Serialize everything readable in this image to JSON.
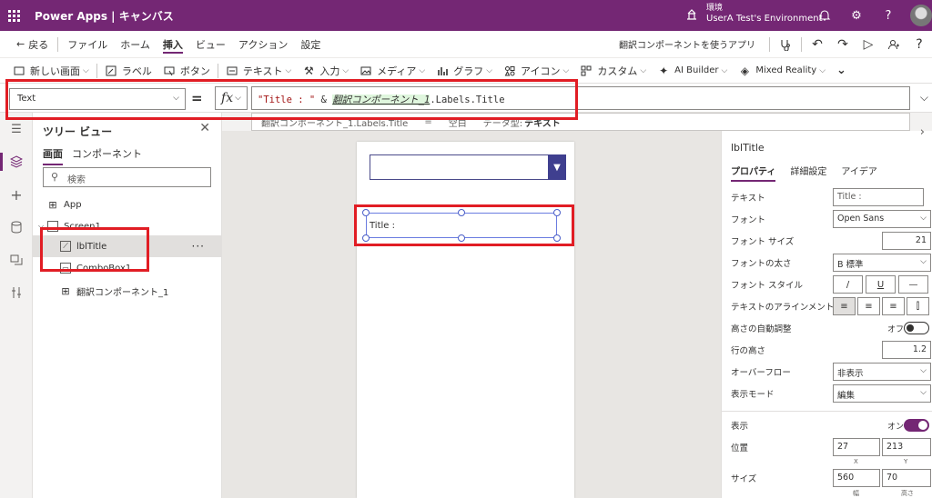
{
  "topbar": {
    "app_title": "Power Apps | キャンバス",
    "env_label": "環境",
    "env_name": "UserA Test's Environment"
  },
  "menu": {
    "back": "戻る",
    "items": [
      "ファイル",
      "ホーム",
      "挿入",
      "ビュー",
      "アクション",
      "設定"
    ],
    "active_item": "挿入",
    "app_name": "翻訳コンポーネントを使うアプリ"
  },
  "toolbar": {
    "new_screen": "新しい画面",
    "label": "ラベル",
    "button": "ボタン",
    "text": "テキスト",
    "input": "入力",
    "media": "メディア",
    "chart": "グラフ",
    "icons": "アイコン",
    "custom": "カスタム",
    "ai_builder": "AI Builder",
    "mixed_reality": "Mixed Reality"
  },
  "formula_bar": {
    "property": "Text",
    "equals": "=",
    "fx": "fx",
    "formula_string": "\"Title : \"",
    "formula_op": " & ",
    "formula_ref": "翻訳コンポーネント_1",
    "formula_tail": ".Labels.Title",
    "hint_expr": "翻訳コンポーネント_1.Labels.Title",
    "hint_eq": "=",
    "hint_value": "空白",
    "hint_type_label": "データ型:",
    "hint_type": "テキスト"
  },
  "tree": {
    "title": "ツリー ビュー",
    "tabs": [
      "画面",
      "コンポーネント"
    ],
    "search_placeholder": "検索",
    "items": {
      "app": "App",
      "screen": "Screen1",
      "label": "lblTitle",
      "combo": "ComboBox1",
      "component": "翻訳コンポーネント_1"
    },
    "more": "···"
  },
  "canvas": {
    "label_text": "Title :"
  },
  "props": {
    "control_name": "lblTitle",
    "tabs": [
      "プロパティ",
      "詳細設定",
      "アイデア"
    ],
    "rows": {
      "text_label": "テキスト",
      "text_value": "Title :",
      "font_label": "フォント",
      "font_value": "Open Sans",
      "font_size_label": "フォント サイズ",
      "font_size_value": "21",
      "font_weight_label": "フォントの太さ",
      "font_weight_value": "B 標準",
      "font_style_label": "フォント スタイル",
      "italic": "/",
      "underline": "U",
      "strike": "—",
      "align_label": "テキストのアラインメント",
      "auto_height_label": "高さの自動調整",
      "auto_height_value": "オフ",
      "line_height_label": "行の高さ",
      "line_height_value": "1.2",
      "overflow_label": "オーバーフロー",
      "overflow_value": "非表示",
      "display_mode_label": "表示モード",
      "display_mode_value": "編集",
      "visible_label": "表示",
      "visible_value": "オン",
      "position_label": "位置",
      "pos_x": "27",
      "pos_y": "213",
      "x_label": "X",
      "y_label": "Y",
      "size_label": "サイズ",
      "width": "560",
      "height": "70",
      "w_label": "幅",
      "h_label": "高さ"
    }
  },
  "colors": {
    "brand": "#742774",
    "highlight": "#e11d24"
  }
}
